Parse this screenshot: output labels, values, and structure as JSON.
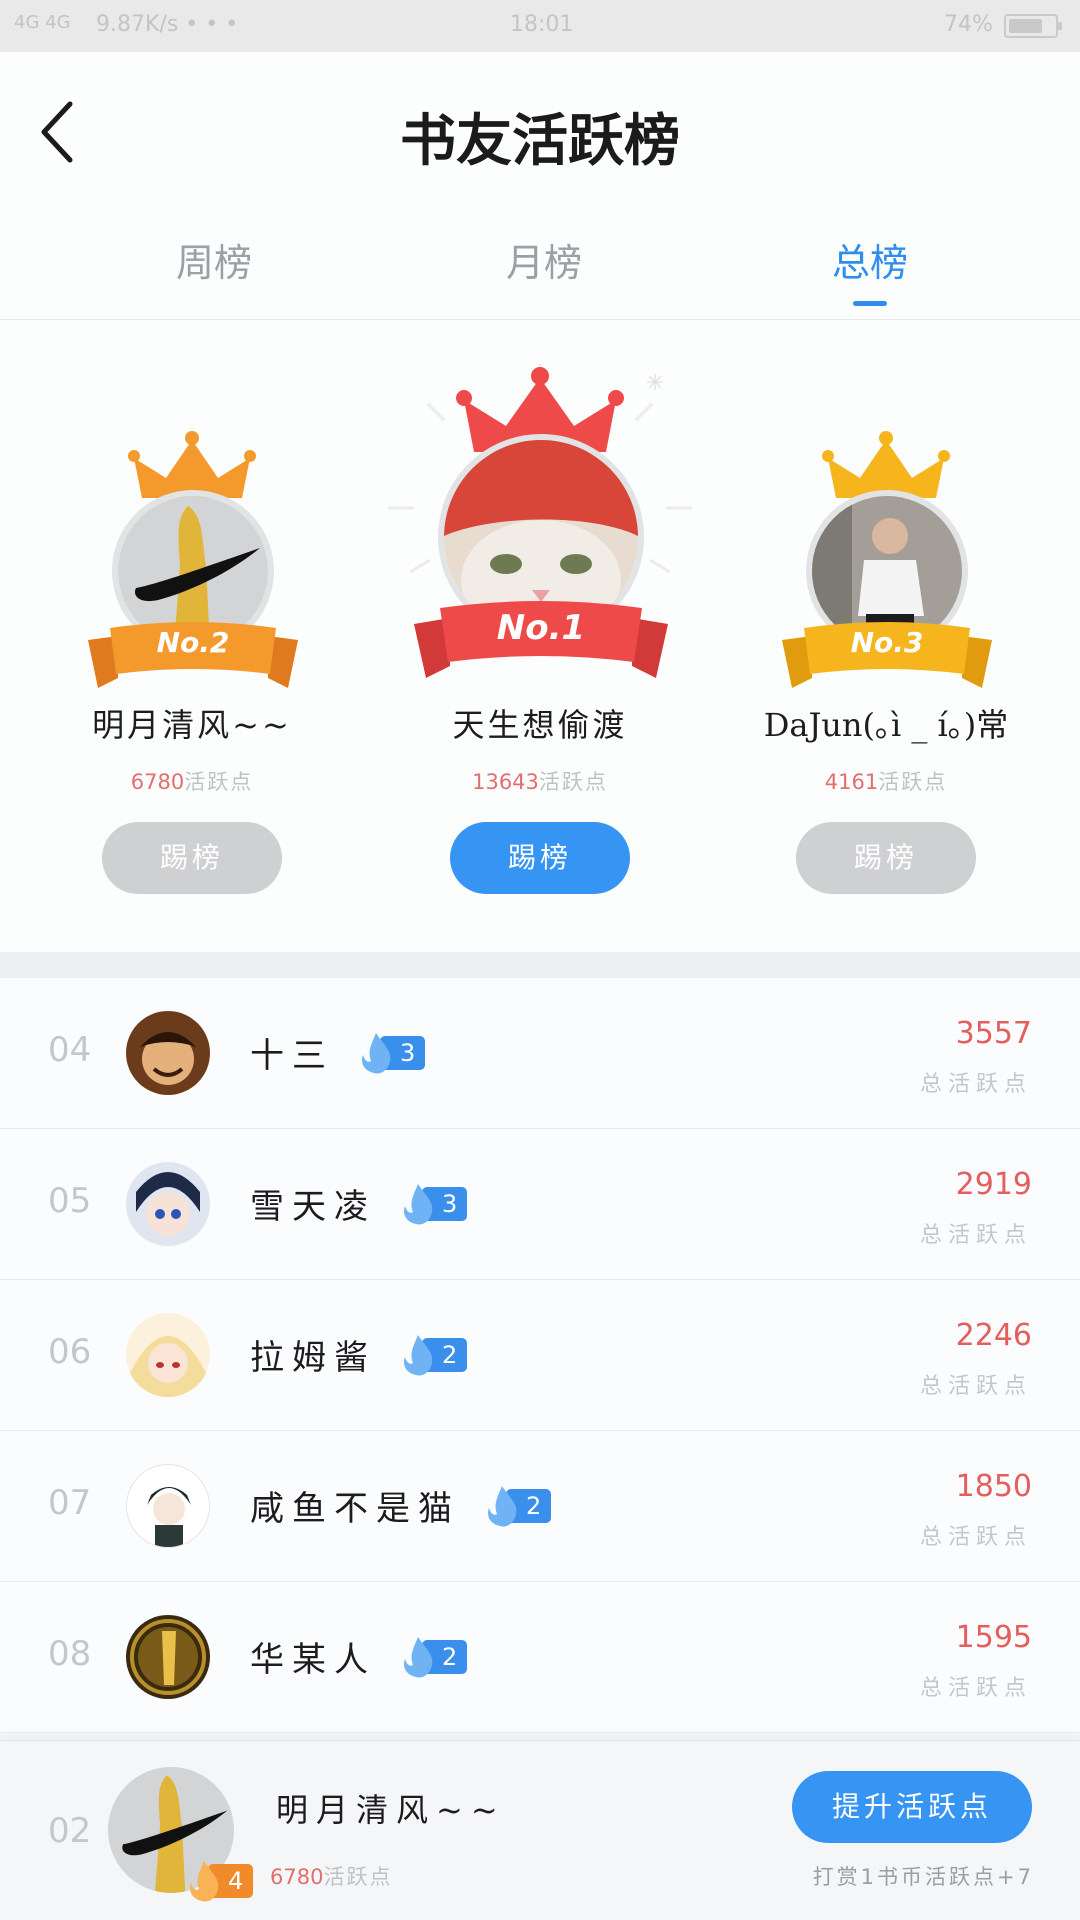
{
  "status_bar": {
    "signal": "4G 4G",
    "net_speed": "9.87K/s • • •",
    "time": "18:01",
    "battery": "74%",
    "battery_level": 0.74
  },
  "header": {
    "title": "书友活跃榜"
  },
  "tabs": [
    {
      "label": "周榜",
      "active": false
    },
    {
      "label": "月榜",
      "active": false
    },
    {
      "label": "总榜",
      "active": true
    }
  ],
  "podium": [
    {
      "rank": "No.2",
      "name": "明月清风~~",
      "points": "6780",
      "points_unit": "活跃点",
      "button": "踢榜"
    },
    {
      "rank": "No.1",
      "name": "天生想偷渡",
      "points": "13643",
      "points_unit": "活跃点",
      "button": "踢榜"
    },
    {
      "rank": "No.3",
      "name": "DaJun(｡ì _ í｡)常",
      "points": "4161",
      "points_unit": "活跃点",
      "button": "踢榜"
    }
  ],
  "list": [
    {
      "rank": "04",
      "name": "十三",
      "level": "3",
      "value": "3557",
      "label": "总活跃点"
    },
    {
      "rank": "05",
      "name": "雪天凌",
      "level": "3",
      "value": "2919",
      "label": "总活跃点"
    },
    {
      "rank": "06",
      "name": "拉姆酱",
      "level": "2",
      "value": "2246",
      "label": "总活跃点"
    },
    {
      "rank": "07",
      "name": "咸鱼不是猫",
      "level": "2",
      "value": "1850",
      "label": "总活跃点"
    },
    {
      "rank": "08",
      "name": "华某人",
      "level": "2",
      "value": "1595",
      "label": "总活跃点"
    }
  ],
  "me": {
    "rank": "02",
    "name": "明月清风~~",
    "level": "4",
    "points": "6780",
    "points_unit": "活跃点",
    "button": "提升活跃点",
    "hint": "打赏1书币活跃点+7"
  },
  "colors": {
    "accent": "#3694f2",
    "points_red": "#e45e5e",
    "gold": "#f6b51c",
    "orange": "#f49a2c",
    "red": "#ef4a4a"
  }
}
